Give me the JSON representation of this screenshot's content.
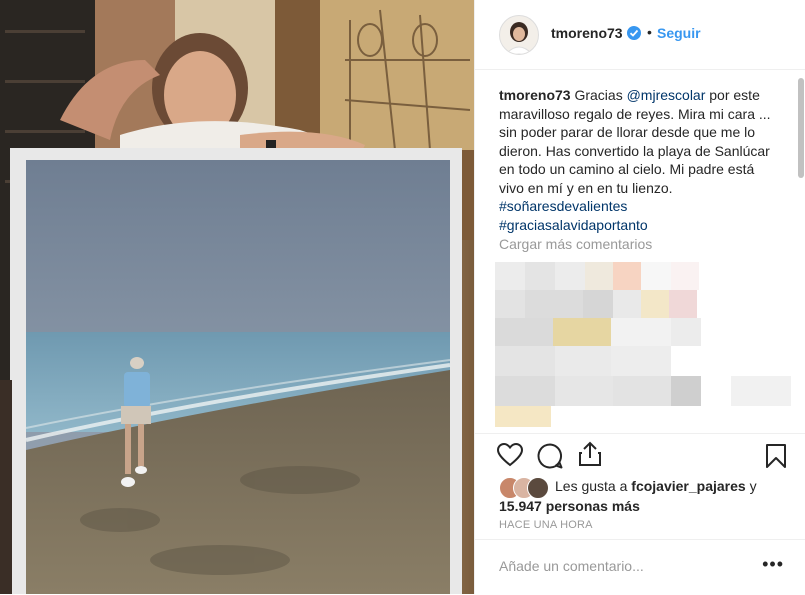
{
  "post": {
    "username": "tmoreno73",
    "dot": "•",
    "follow_label": "Seguir",
    "caption_user": "tmoreno73",
    "caption_parts": [
      " Gracias ",
      "@mjrescolar",
      " por este maravilloso regalo de reyes. Mira mi cara ... sin poder parar de llorar desde que me lo dieron. Has convertido la playa de Sanlúcar en todo un camino al cielo. Mi padre está vivo en mí y en en tu lienzo. ",
      "#soñaresdevalientes",
      " ",
      "#graciasalavidaportanto"
    ],
    "load_more": "Cargar más comentarios",
    "likes_prefix": "Les gusta a ",
    "likes_user": "fcojavier_pajares",
    "likes_mid": " y ",
    "likes_count": "15.947 personas más",
    "timestamp": "HACE UNA HORA",
    "comment_placeholder": "Añade un comentario...",
    "options": "•••"
  },
  "colors": {
    "accent": "#3897f0",
    "link": "#003569",
    "muted": "#999999"
  },
  "icons": [
    "heart-icon",
    "comment-icon",
    "share-icon",
    "bookmark-icon",
    "verified-badge-icon"
  ]
}
